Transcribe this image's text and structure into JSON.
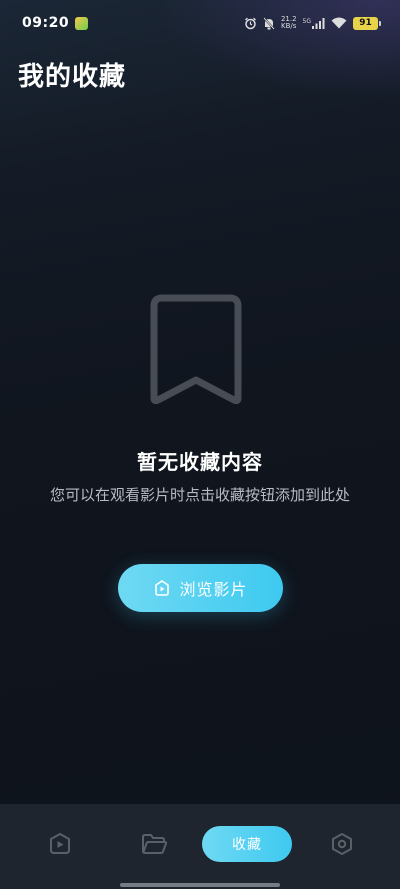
{
  "status_bar": {
    "time": "09:20",
    "net_speed_value": "21.2",
    "net_speed_unit": "KB/s",
    "signal_label": "5G",
    "battery": "91"
  },
  "header": {
    "title": "我的收藏"
  },
  "empty_state": {
    "icon": "bookmark-icon",
    "title": "暂无收藏内容",
    "description": "您可以在观看影片时点击收藏按钮添加到此处",
    "button_label": "浏览影片",
    "button_icon": "play-square-icon"
  },
  "bottom_nav": {
    "items": [
      {
        "icon": "play-icon",
        "active": false
      },
      {
        "icon": "folder-icon",
        "active": false
      },
      {
        "label": "收藏",
        "active": true
      },
      {
        "icon": "settings-hex-icon",
        "active": false
      }
    ]
  },
  "colors": {
    "accent": "#3ec9f0",
    "background": "#10151e",
    "nav_background": "#1f252e",
    "muted_icon": "#4a4f57"
  }
}
